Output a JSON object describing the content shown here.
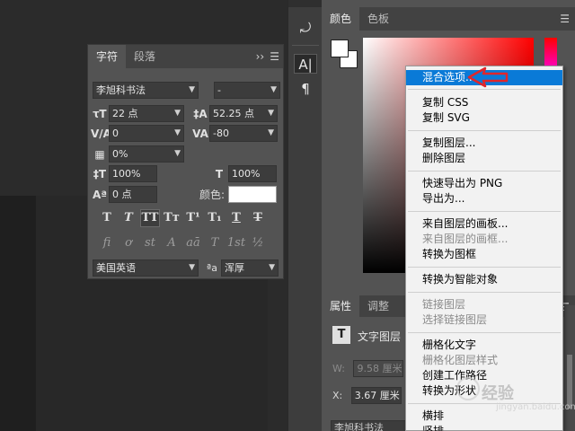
{
  "character_panel": {
    "tabs": [
      "字符",
      "段落"
    ],
    "collapse_glyph": "››",
    "menu_glyph": "☰",
    "font_family": "李旭科书法",
    "font_style": "-",
    "font_size": "22 点",
    "leading": "52.25 点",
    "kerning": "0",
    "tracking": "-80",
    "tsume": "0%",
    "vertical_scale": "100%",
    "horizontal_scale": "100%",
    "baseline_shift": "0 点",
    "color_label": "颜色:",
    "color_value": "#ffffff",
    "type_styles": [
      "T",
      "T",
      "TT",
      "Tт",
      "T¹",
      "T₁",
      "T",
      "T"
    ],
    "opentype": [
      "fi",
      "ơ",
      "st",
      "A",
      "aā",
      "T",
      "1st",
      "½"
    ],
    "language": "美国英语",
    "aa_label": "ªa",
    "anti_alias": "浑厚"
  },
  "tool_strip": {
    "buttons": [
      "history-icon",
      "character-icon",
      "paragraph-icon"
    ],
    "glyphs": [
      "⤾",
      "A|",
      "¶"
    ]
  },
  "color_panel": {
    "tabs": [
      "颜色",
      "色板"
    ],
    "foreground": "#ffffff",
    "background": "#ffffff",
    "menu_glyph": "☰"
  },
  "properties_panel": {
    "tabs": [
      "属性",
      "调整"
    ],
    "title": "文字图层",
    "w_label": "W:",
    "w_value": "9.58 厘米",
    "x_label": "X:",
    "x_value": "3.67 厘米",
    "font_value": "李旭科书法",
    "menu_glyph": "☰"
  },
  "context_menu": {
    "items": [
      {
        "label": "混合选项...",
        "state": "highlighted"
      },
      {
        "label": "复制 CSS",
        "state": "enabled"
      },
      {
        "label": "复制 SVG",
        "state": "enabled"
      },
      {
        "label": "复制图层...",
        "state": "enabled"
      },
      {
        "label": "删除图层",
        "state": "enabled"
      },
      {
        "label": "快速导出为 PNG",
        "state": "enabled"
      },
      {
        "label": "导出为...",
        "state": "enabled"
      },
      {
        "label": "来自图层的画板...",
        "state": "enabled"
      },
      {
        "label": "来自图层的画框...",
        "state": "disabled"
      },
      {
        "label": "转换为图框",
        "state": "enabled"
      },
      {
        "label": "转换为智能对象",
        "state": "enabled"
      },
      {
        "label": "链接图层",
        "state": "disabled"
      },
      {
        "label": "选择链接图层",
        "state": "disabled"
      },
      {
        "label": "栅格化文字",
        "state": "enabled"
      },
      {
        "label": "栅格化图层样式",
        "state": "disabled"
      },
      {
        "label": "创建工作路径",
        "state": "enabled"
      },
      {
        "label": "转换为形状",
        "state": "enabled"
      },
      {
        "label": "横排",
        "state": "enabled"
      },
      {
        "label": "竖排",
        "state": "enabled"
      }
    ]
  },
  "annotation": {
    "arrow_color": "#e0262b"
  },
  "watermark": {
    "text": "经验",
    "sub": "jingyan.baidu.com"
  }
}
